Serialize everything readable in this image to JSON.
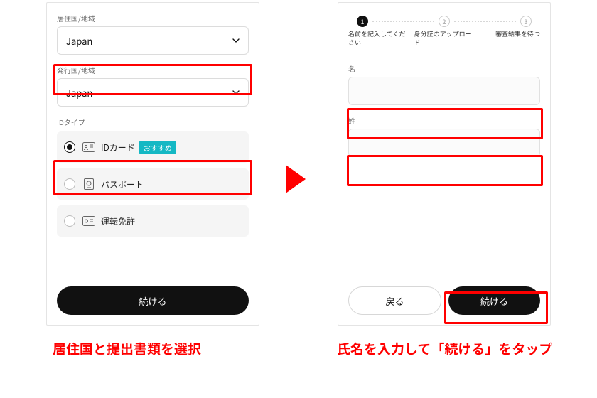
{
  "left_panel": {
    "residence_label": "居住国/地域",
    "residence_value": "Japan",
    "issuing_label": "発行国/地域",
    "issuing_value": "Japan",
    "id_type_label": "IDタイプ",
    "options": {
      "id_card": "IDカード",
      "id_card_badge": "おすすめ",
      "passport": "パスポート",
      "drivers_license": "運転免許"
    },
    "continue_button": "続ける"
  },
  "right_panel": {
    "steps": {
      "s1_num": "1",
      "s2_num": "2",
      "s3_num": "3",
      "s1_label": "名前を記入してください",
      "s2_label": "身分証のアップロード",
      "s3_label": "審査結果を待つ"
    },
    "first_name_label": "名",
    "last_name_label": "姓",
    "back_button": "戻る",
    "continue_button": "続ける"
  },
  "captions": {
    "left": "居住国と提出書類を選択",
    "right": "氏名を入力して「続ける」をタップ"
  }
}
